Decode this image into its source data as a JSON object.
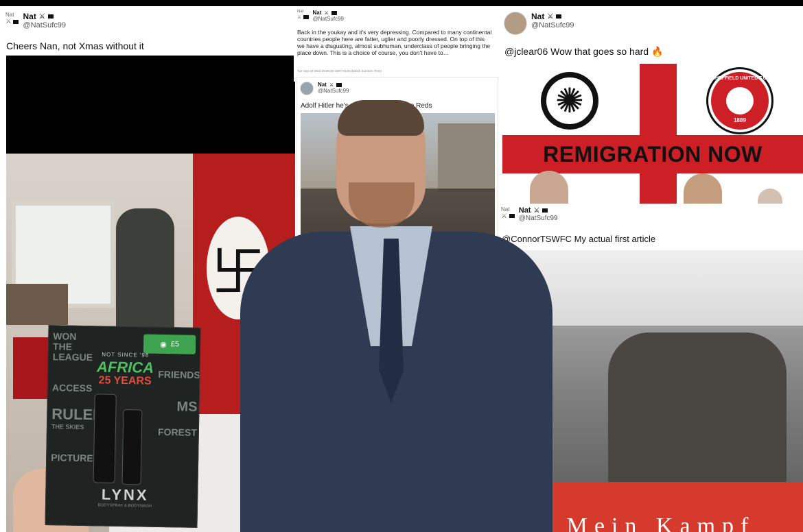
{
  "tweet_left": {
    "display_name": "Nat",
    "handle": "@NatSufc99",
    "avatar_alt": "Nat",
    "text": "Cheers Nan, not Xmas without it",
    "product": {
      "price": "£5",
      "since": "NOT SINCE '98",
      "headline": "AFRICA",
      "subheadline": "25 YEARS",
      "brand": "LYNX",
      "fine_print": "BODYSPRAY & BODYWASH",
      "left_words": [
        "WON THE",
        "LEAGUE",
        "ACCESS",
        "RULED",
        "THE SKIES",
        "PICTURE"
      ],
      "right_words": [
        "FRIENDS",
        "MS",
        "FOREST"
      ]
    }
  },
  "tweet_top_middle": {
    "display_name": "Nat",
    "handle": "@NatSufc99",
    "avatar_alt": "Nat",
    "text": "Back in the youkay and it's very depressing. Compared to many continental countries people here are fatter, uglier and poorly dressed. On top of this we have a disgusting, almost subhuman, underclass of people bringing the place down. This is a choice of course, you don't have to…",
    "timestamp": "Tue Sep 10 2024 09:06:26 GMT+0100 (British Summer Time)"
  },
  "tweet_middle_quote": {
    "display_name": "Nat",
    "handle": "@NatSufc99",
    "text": "Adolf Hitler he's not d… …hod for the Reds"
  },
  "tweet_top_right": {
    "display_name": "Nat",
    "handle": "@NatSufc99",
    "text": "@jclear06 Wow that goes so hard",
    "emoji": "🔥",
    "banner_slogan": "REMIGRATION NOW",
    "badge_title": "SHEFFIELD UNITED F.C.",
    "badge_year": "1889"
  },
  "tweet_bottom_right": {
    "display_name": "Nat",
    "handle": "@NatSufc99",
    "avatar_alt": "Nat",
    "text": "@ConnorTSWFC My actual first article",
    "cover_title": "Mein Kampf"
  },
  "colors": {
    "flag_red": "#b51e1d",
    "cross_red": "#cd1f26",
    "suit_navy": "#2e3b52",
    "cover_red": "#d63a2c",
    "lynx_green": "#4fc062"
  },
  "icons": [
    "swords-icon",
    "flag-icon",
    "fire-icon"
  ]
}
